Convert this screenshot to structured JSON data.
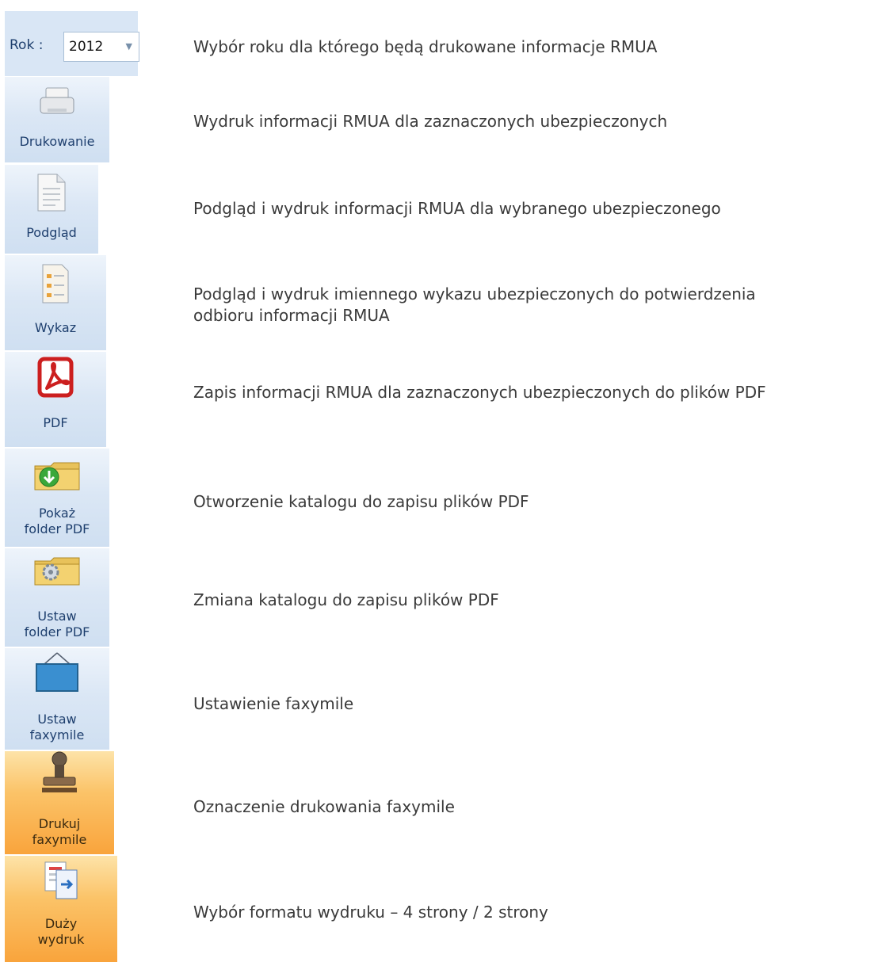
{
  "year": {
    "label": "Rok :",
    "value": "2012"
  },
  "buttons": [
    {
      "label": "Drukowanie",
      "icon": "printer-icon"
    },
    {
      "label": "Podgląd",
      "icon": "document-icon"
    },
    {
      "label": "Wykaz",
      "icon": "list-document-icon"
    },
    {
      "label": "PDF",
      "icon": "pdf-icon"
    },
    {
      "label": "Pokaż\nfolder PDF",
      "icon": "folder-download-icon"
    },
    {
      "label": "Ustaw\nfolder PDF",
      "icon": "folder-settings-icon"
    },
    {
      "label": "Ustaw\nfaxymile",
      "icon": "frame-icon"
    },
    {
      "label": "Drukuj\nfaxymile",
      "icon": "stamp-icon",
      "active": true
    },
    {
      "label": "Duży\nwydruk",
      "icon": "large-print-icon",
      "active": true
    }
  ],
  "descriptions": [
    "Wybór roku dla którego będą drukowane informacje RMUA",
    "Wydruk informacji RMUA dla zaznaczonych ubezpieczonych",
    "Podgląd i wydruk informacji RMUA dla wybranego ubezpieczonego",
    "Podgląd i wydruk imiennego wykazu ubezpieczonych do potwierdzenia odbioru informacji RMUA",
    "Zapis informacji RMUA dla zaznaczonych ubezpieczonych do plików PDF",
    "Otworzenie katalogu do zapisu plików PDF",
    "Zmiana katalogu do zapisu plików PDF",
    "Ustawienie faxymile",
    "Oznaczenie drukowania faxymile",
    "Wybór formatu wydruku – 4 strony / 2 strony"
  ],
  "colors": {
    "ribbon_blue": "#d9e6f5",
    "active_orange": "#f9a43c",
    "label_blue": "#1e3f6e",
    "pdf_red": "#cc1f1f"
  }
}
